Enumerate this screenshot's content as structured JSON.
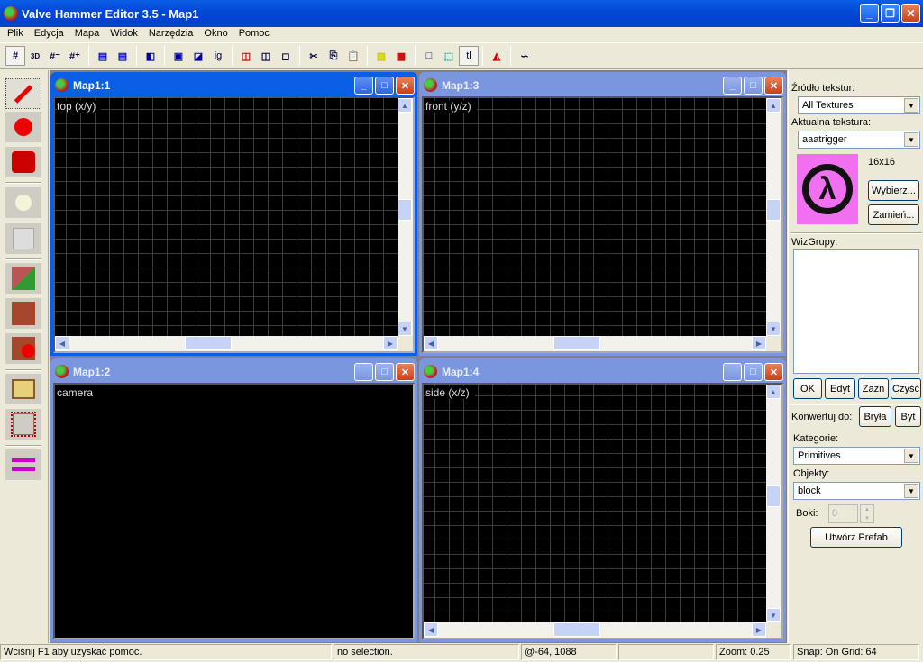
{
  "window": {
    "title": "Valve Hammer Editor 3.5 - Map1"
  },
  "menu": [
    "Plik",
    "Edycja",
    "Mapa",
    "Widok",
    "Narzędzia",
    "Okno",
    "Pomoc"
  ],
  "toolbar": {
    "grid3d": "3D",
    "texlock": "ig",
    "toggle_text": "tl"
  },
  "viewports": [
    {
      "title": "Map1:1",
      "label": "top (x/y)"
    },
    {
      "title": "Map1:3",
      "label": "front (y/z)"
    },
    {
      "title": "Map1:2",
      "label": "camera"
    },
    {
      "title": "Map1:4",
      "label": "side (x/z)"
    }
  ],
  "panel": {
    "texture_source_label": "Źródło tekstur:",
    "texture_source": "All Textures",
    "current_texture_label": "Aktualna tekstura:",
    "current_texture": "aaatrigger",
    "texture_size": "16x16",
    "browse": "Wybierz...",
    "replace": "Zamień...",
    "visgroups_label": "WizGrupy:",
    "ok": "OK",
    "edit": "Edyt",
    "mark": "Zazn",
    "purge": "Czyść",
    "convert_label": "Konwertuj do:",
    "brush": "Bryła",
    "entity": "Byt",
    "categories_label": "Kategorie:",
    "category": "Primitives",
    "objects_label": "Objekty:",
    "object": "block",
    "faces_label": "Boki:",
    "faces": "0",
    "create_prefab": "Utwórz Prefab"
  },
  "status": {
    "help": "Wciśnij F1 aby uzyskać pomoc.",
    "selection": "no selection.",
    "coords": "@-64, 1088",
    "extra": "",
    "zoom": "Zoom: 0.25",
    "snap": "Snap: On Grid: 64"
  }
}
